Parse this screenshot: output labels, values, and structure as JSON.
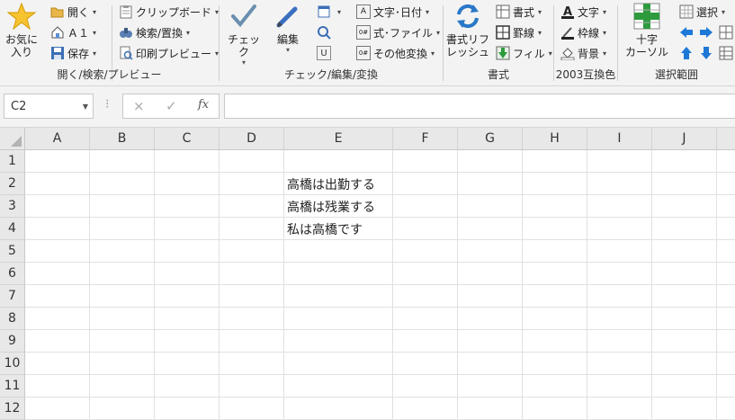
{
  "ribbon": {
    "group1": {
      "label": "開く/検索/プレビュー",
      "favorites": "お気に\n入り",
      "open": "開く",
      "a1": "Ａ１",
      "save": "保存",
      "clipboard": "クリップボード",
      "find_replace": "検索/置換",
      "print_preview": "印刷プレビュー"
    },
    "group2": {
      "label": "チェック/編集/変換",
      "check": "チェック",
      "edit": "編集",
      "text_date": "文字･日付",
      "formula_file": "式･ファイル",
      "other_convert": "その他変換"
    },
    "group3": {
      "label": "書式",
      "refresh": "書式リフ\nレッシュ",
      "format": "書式",
      "border": "罫線",
      "fill": "フィル"
    },
    "group4": {
      "label": "2003互換色",
      "text": "文字",
      "border": "枠線",
      "background": "背景"
    },
    "group5": {
      "label": "選択範囲",
      "cross_cursor": "十字\nカーソル",
      "select": "選択"
    }
  },
  "formula_bar": {
    "name_box": "C2",
    "cancel_icon": "×",
    "enter_icon": "✓",
    "fx_icon": "fx",
    "value": ""
  },
  "sheet": {
    "columns": [
      "A",
      "B",
      "C",
      "D",
      "E",
      "F",
      "G",
      "H",
      "I",
      "J"
    ],
    "rows": [
      "1",
      "2",
      "3",
      "4",
      "5",
      "6",
      "7",
      "8",
      "9",
      "10",
      "11",
      "12"
    ],
    "cells": {
      "E2": "高橋は出勤する",
      "E3": "高橋は残業する",
      "E4": "私は高橋です"
    }
  },
  "colors": {
    "ribbon_bg": "#f3f3f3",
    "header_bg": "#e8e8e8",
    "grid_line": "#e1e1e1",
    "accent_blue": "#1e78d7",
    "accent_green": "#2e9a3e"
  }
}
